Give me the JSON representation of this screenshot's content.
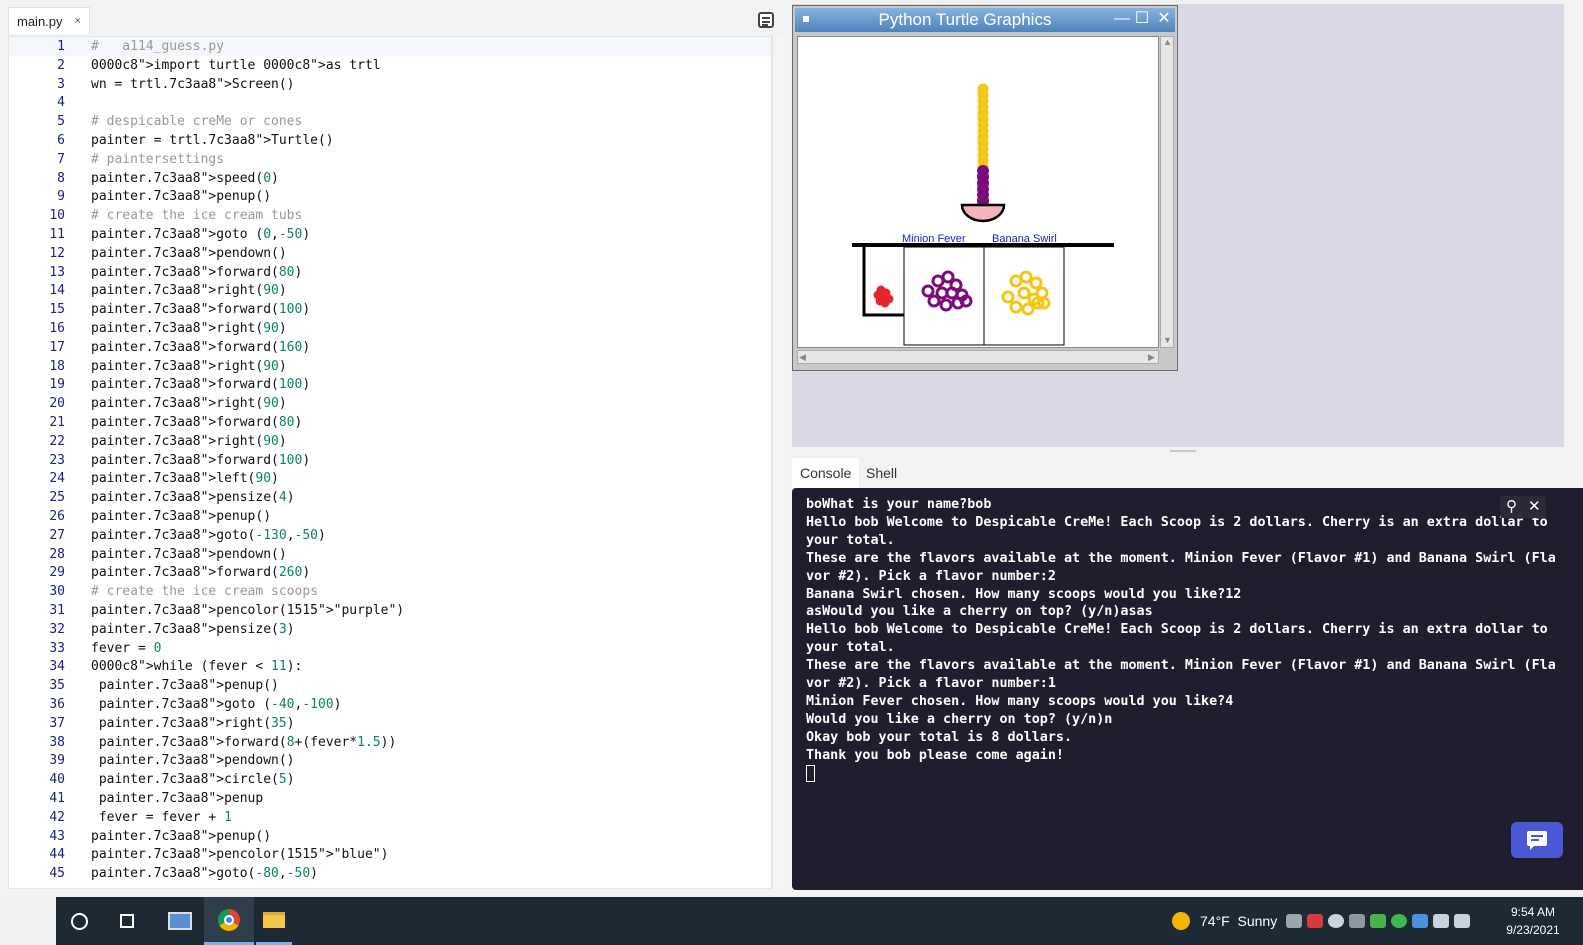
{
  "editor": {
    "tab_label": "main.py",
    "tab_close": "×",
    "lines": [
      {
        "n": "1",
        "text": "#   a114_guess.py"
      },
      {
        "n": "2",
        "text": "import turtle as trtl"
      },
      {
        "n": "3",
        "text": "wn = trtl.Screen()"
      },
      {
        "n": "4",
        "text": ""
      },
      {
        "n": "5",
        "text": "# despicable creMe or cones"
      },
      {
        "n": "6",
        "text": "painter = trtl.Turtle()"
      },
      {
        "n": "7",
        "text": "# paintersettings"
      },
      {
        "n": "8",
        "text": "painter.speed(0)"
      },
      {
        "n": "9",
        "text": "painter.penup()"
      },
      {
        "n": "10",
        "text": "# create the ice cream tubs"
      },
      {
        "n": "11",
        "text": "painter.goto (0,-50)"
      },
      {
        "n": "12",
        "text": "painter.pendown()"
      },
      {
        "n": "13",
        "text": "painter.forward(80)"
      },
      {
        "n": "14",
        "text": "painter.right(90)"
      },
      {
        "n": "15",
        "text": "painter.forward(100)"
      },
      {
        "n": "16",
        "text": "painter.right(90)"
      },
      {
        "n": "17",
        "text": "painter.forward(160)"
      },
      {
        "n": "18",
        "text": "painter.right(90)"
      },
      {
        "n": "19",
        "text": "painter.forward(100)"
      },
      {
        "n": "20",
        "text": "painter.right(90)"
      },
      {
        "n": "21",
        "text": "painter.forward(80)"
      },
      {
        "n": "22",
        "text": "painter.right(90)"
      },
      {
        "n": "23",
        "text": "painter.forward(100)"
      },
      {
        "n": "24",
        "text": "painter.left(90)"
      },
      {
        "n": "25",
        "text": "painter.pensize(4)"
      },
      {
        "n": "26",
        "text": "painter.penup()"
      },
      {
        "n": "27",
        "text": "painter.goto(-130,-50)"
      },
      {
        "n": "28",
        "text": "painter.pendown()"
      },
      {
        "n": "29",
        "text": "painter.forward(260)"
      },
      {
        "n": "30",
        "text": "# create the ice cream scoops"
      },
      {
        "n": "31",
        "text": "painter.pencolor(\"purple\")"
      },
      {
        "n": "32",
        "text": "painter.pensize(3)"
      },
      {
        "n": "33",
        "text": "fever = 0"
      },
      {
        "n": "34",
        "text": "while (fever < 11):"
      },
      {
        "n": "35",
        "text": " painter.penup()"
      },
      {
        "n": "36",
        "text": " painter.goto (-40,-100)"
      },
      {
        "n": "37",
        "text": " painter.right(35)"
      },
      {
        "n": "38",
        "text": " painter.forward(8+(fever*1.5))"
      },
      {
        "n": "39",
        "text": " painter.pendown()"
      },
      {
        "n": "40",
        "text": " painter.circle(5)"
      },
      {
        "n": "41",
        "text": " painter.penup"
      },
      {
        "n": "42",
        "text": " fever = fever + 1"
      },
      {
        "n": "43",
        "text": "painter.penup()"
      },
      {
        "n": "44",
        "text": "painter.pencolor(\"blue\")"
      },
      {
        "n": "45",
        "text": "painter.goto(-80,-50)"
      }
    ]
  },
  "turtle_window": {
    "title": "Python Turtle Graphics",
    "label_minion": "Minion Fever",
    "label_banana": "Banana Swirl",
    "colors": {
      "yellow": "#f5c518",
      "purple": "#7b0c7b",
      "bowl": "#f4b3bd",
      "red": "#e4262a",
      "label": "#1a1acc"
    }
  },
  "console": {
    "tab_console": "Console",
    "tab_shell": "Shell",
    "lines": [
      "boWhat is your name?bob",
      "Hello bob Welcome to Despicable CreMe! Each Scoop is 2 dollars. Cherry is an extra dollar to",
      "your total.",
      "These are the flavors available at the moment. Minion Fever (Flavor #1) and Banana Swirl (Fla",
      "vor #2). Pick a flavor number:2",
      "Banana Swirl chosen. How many scoops would you like?12",
      "asWould you like a cherry on top? (y/n)asas",
      "Hello bob Welcome to Despicable CreMe! Each Scoop is 2 dollars. Cherry is an extra dollar to",
      "your total.",
      "These are the flavors available at the moment. Minion Fever (Flavor #1) and Banana Swirl (Fla",
      "vor #2). Pick a flavor number:1",
      "Minion Fever chosen. How many scoops would you like?4",
      "Would you like a cherry on top? (y/n)n",
      "Okay bob your total is 8 dollars.",
      "Thank you bob please come again!"
    ]
  },
  "taskbar": {
    "weather_temp": "74°F",
    "weather_desc": "Sunny",
    "time": "9:54 AM",
    "date": "9/23/2021"
  }
}
